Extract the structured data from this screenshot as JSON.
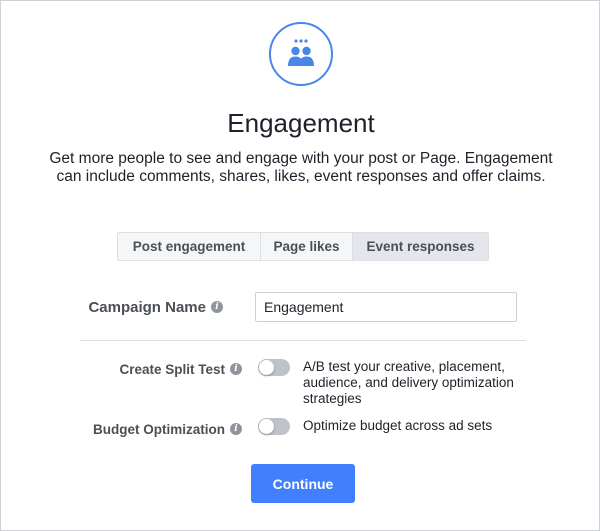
{
  "header": {
    "icon": "people-icon",
    "title": "Engagement",
    "description": "Get more people to see and engage with your post or Page. Engagement can include comments, shares, likes, event responses and offer claims."
  },
  "tabs": [
    {
      "label": "Post engagement",
      "selected": false
    },
    {
      "label": "Page likes",
      "selected": false
    },
    {
      "label": "Event responses",
      "selected": true
    }
  ],
  "campaign_name": {
    "label": "Campaign Name",
    "value": "Engagement"
  },
  "split_test": {
    "label": "Create Split Test",
    "enabled": false,
    "description": "A/B test your creative, placement, audience, and delivery optimization strategies"
  },
  "budget_optimization": {
    "label": "Budget Optimization",
    "enabled": false,
    "description": "Optimize budget across ad sets"
  },
  "actions": {
    "continue_label": "Continue"
  },
  "colors": {
    "accent": "#4080ff",
    "icon_ring": "#4a86e8"
  }
}
